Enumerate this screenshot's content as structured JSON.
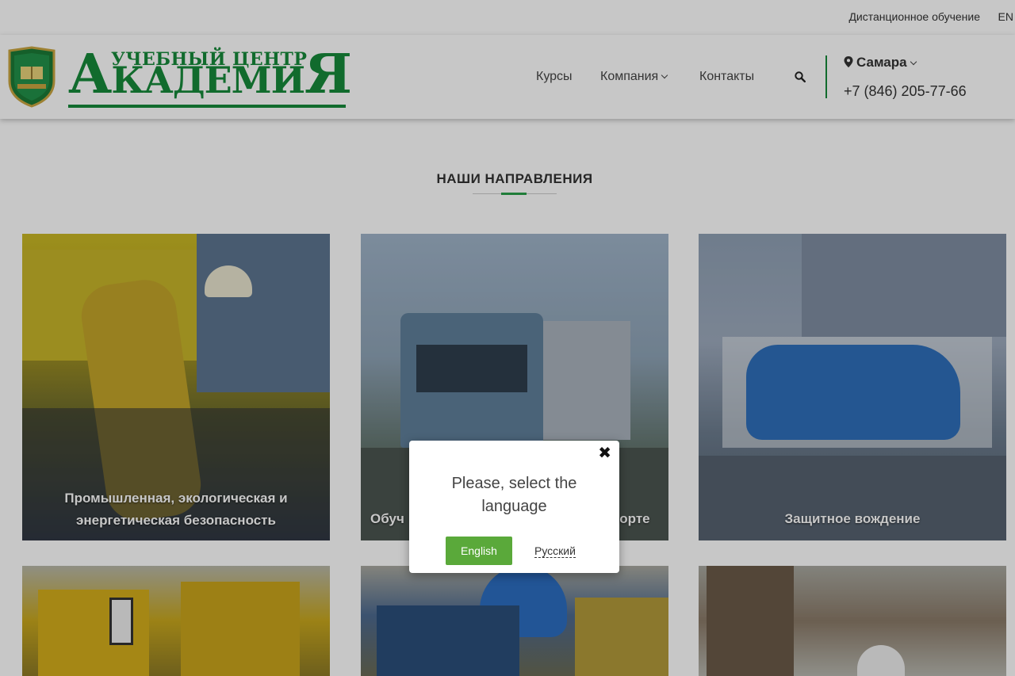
{
  "topbar": {
    "distance_learning": "Дистанционное обучение",
    "language": "EN"
  },
  "header": {
    "logo_small": "УЧЕБНЫЙ ЦЕНТР",
    "logo_big_first": "А",
    "logo_big_middle": "КАДЕМИ",
    "logo_big_last": "Я",
    "crest_text": "АКАДЕМИЯ",
    "nav": {
      "courses": "Курсы",
      "company": "Компания",
      "contacts": "Контакты"
    },
    "city": "Самара",
    "phone": "+7 (846) 205-77-66"
  },
  "section": {
    "title": "НАШИ НАПРАВЛЕНИЯ"
  },
  "cards": [
    {
      "caption_line1": "Промышленная, экологическая и",
      "caption_line2": "энергетическая безопасность"
    },
    {
      "caption_left": "Обуч",
      "caption_right": "порте"
    },
    {
      "caption": "Защитное вождение"
    }
  ],
  "modal": {
    "close": "✖",
    "message_line1": "Please, select the",
    "message_line2": "language",
    "english_button": "English",
    "russian_link": "Русский"
  },
  "colors": {
    "brand_green": "#168a3a",
    "button_green": "#5aa93a",
    "accent_green": "#2aa14a"
  }
}
